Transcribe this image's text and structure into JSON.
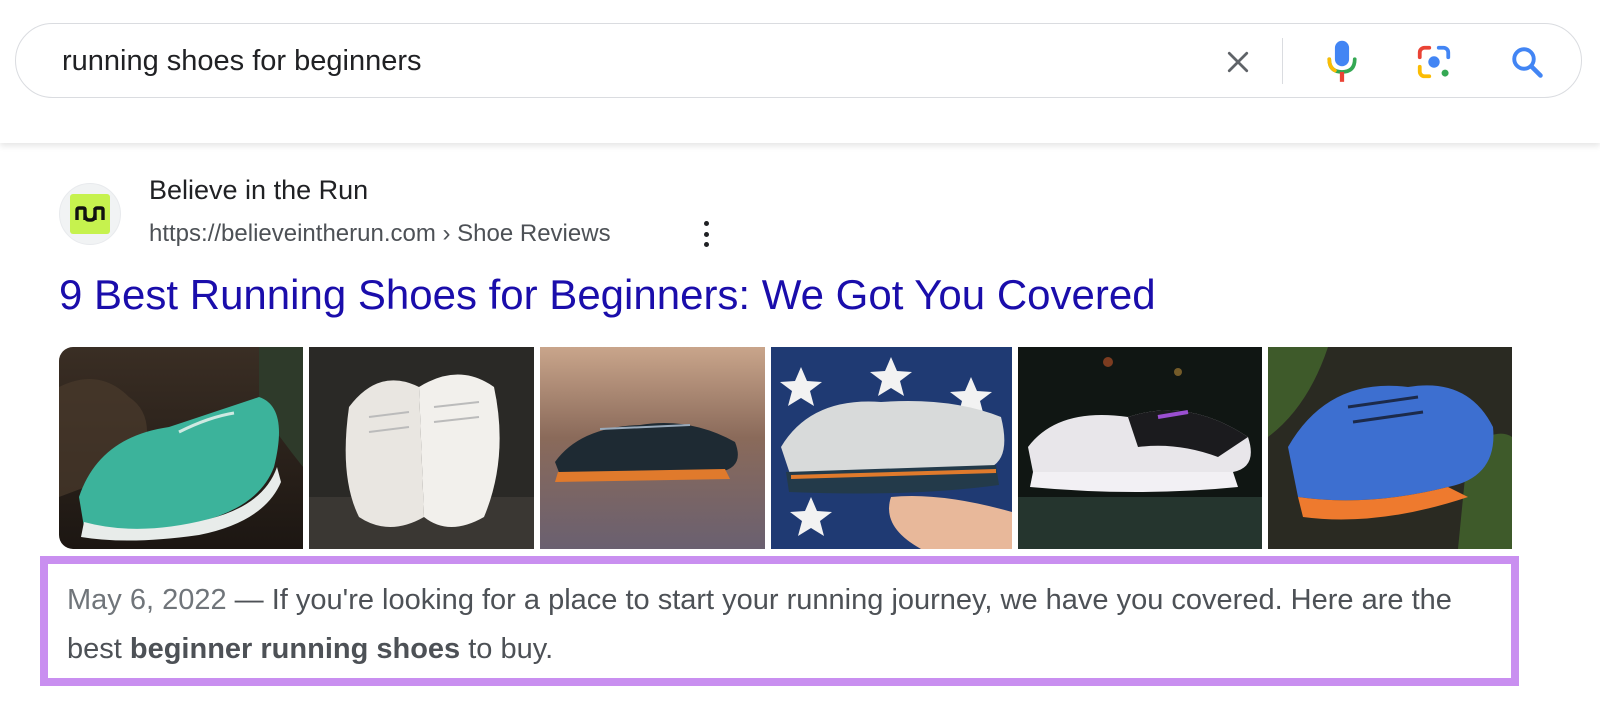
{
  "search": {
    "query": "running shoes for beginners",
    "clear_icon": "close-icon",
    "voice_icon": "microphone-icon",
    "lens_icon": "camera-lens-icon",
    "search_icon": "search-icon"
  },
  "result": {
    "favicon_text": "run",
    "site_name": "Believe in the Run",
    "url": "https://believeintherun.com › Shoe Reviews",
    "title": "9 Best Running Shoes for Beginners: We Got You Covered",
    "images": [
      {
        "name": "teal running shoe"
      },
      {
        "name": "white running shoes"
      },
      {
        "name": "dark running shoes"
      },
      {
        "name": "grey running shoe held on stars"
      },
      {
        "name": "white and black running shoe"
      },
      {
        "name": "blue running shoes"
      }
    ],
    "snippet": {
      "date": "May 6, 2022",
      "separator": " — ",
      "text_before": "If you're looking for a place to start your running journey, we have you covered. Here are the best ",
      "bold": "beginner running shoes",
      "text_after": " to buy."
    }
  },
  "colors": {
    "link": "#1a0dab",
    "highlight_border": "#c98ff0",
    "favicon_bg": "#c6f24e"
  }
}
